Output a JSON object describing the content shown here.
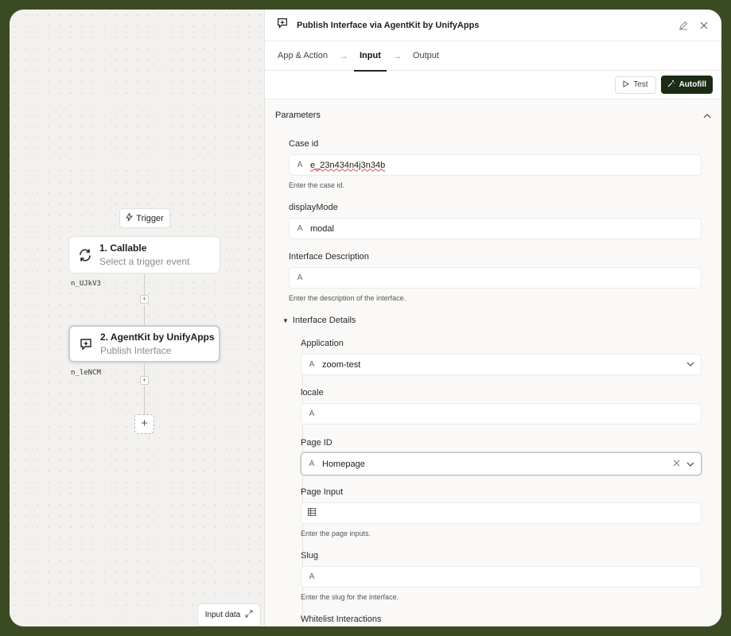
{
  "canvas": {
    "trigger_label": "Trigger",
    "nodes": [
      {
        "title": "1. Callable",
        "subtitle": "Select a trigger event",
        "id": "n_UJkV3",
        "icon": "sync-icon"
      },
      {
        "title": "2. AgentKit by UnifyApps",
        "subtitle": "Publish Interface",
        "id": "n_leNCM",
        "icon": "agentkit-icon"
      }
    ],
    "add_step_label": "+",
    "input_data_label": "Input data"
  },
  "panel": {
    "title": "Publish Interface via AgentKit by UnifyApps",
    "tabs": [
      {
        "label": "App & Action"
      },
      {
        "label": "Input"
      },
      {
        "label": "Output"
      }
    ],
    "toolbar": {
      "test_label": "Test",
      "autofill_label": "Autofill"
    },
    "section_title": "Parameters",
    "fields": {
      "case_id": {
        "label": "Case id",
        "value": "e_23n434n4j3n34b",
        "hint": "Enter the case id."
      },
      "display_mode": {
        "label": "displayMode",
        "value": "modal"
      },
      "interface_description": {
        "label": "Interface Description",
        "value": "",
        "hint": "Enter the description of the interface."
      },
      "interface_details": {
        "label": "Interface Details"
      },
      "application": {
        "label": "Application",
        "value": "zoom-test"
      },
      "locale": {
        "label": "locale",
        "value": ""
      },
      "page_id": {
        "label": "Page ID",
        "value": "Homepage"
      },
      "page_input": {
        "label": "Page Input",
        "value": "",
        "hint": "Enter the page inputs."
      },
      "slug": {
        "label": "Slug",
        "value": "",
        "hint": "Enter the slug for the interface."
      },
      "whitelist": {
        "label": "Whitelist Interactions"
      }
    }
  },
  "colors": {
    "accent": "#1c2b14",
    "frame": "#3a4a22",
    "error_underline": "#d54b4b"
  }
}
